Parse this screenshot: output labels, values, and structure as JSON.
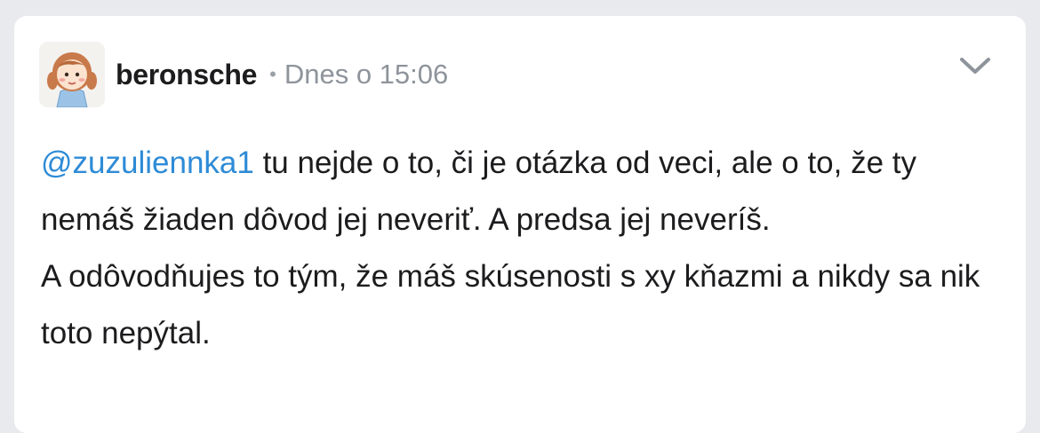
{
  "post": {
    "author": "beronsche",
    "separator": "•",
    "timestamp": "Dnes o 15:06",
    "mention": "@zuzuliennka1",
    "paragraph1_rest": " tu nejde o to, či je otázka od veci, ale o to, že ty nemáš žiaden dôvod jej neveriť. A predsa jej neveríš.",
    "paragraph2": "A odôvodňujes to tým, že máš skúsenosti s xy kňazmi a nikdy sa nik toto nepýtal."
  },
  "icons": {
    "avatar": "cartoon-girl-avatar",
    "menu": "chevron-down-icon"
  },
  "colors": {
    "mention": "#2e8bd6",
    "timestamp": "#8e949b",
    "background": "#e9eaee",
    "card": "#ffffff"
  }
}
